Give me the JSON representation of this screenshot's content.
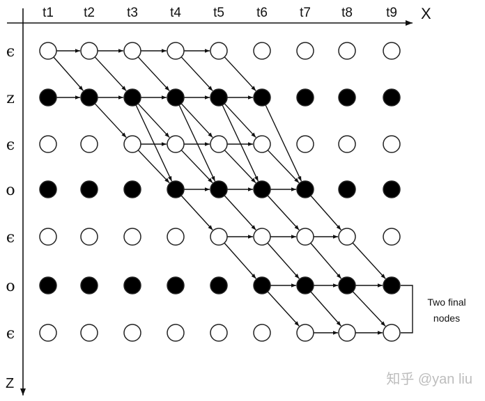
{
  "axes": {
    "x_label": "X",
    "z_label": "Z"
  },
  "columns": [
    "t1",
    "t2",
    "t3",
    "t4",
    "t5",
    "t6",
    "t7",
    "t8",
    "t9"
  ],
  "rows": [
    {
      "label": "ϵ",
      "type": "blank"
    },
    {
      "label": "z",
      "type": "label"
    },
    {
      "label": "ϵ",
      "type": "blank"
    },
    {
      "label": "o",
      "type": "label"
    },
    {
      "label": "ϵ",
      "type": "blank"
    },
    {
      "label": "o",
      "type": "label"
    },
    {
      "label": "ϵ",
      "type": "blank"
    }
  ],
  "edges": [
    [
      0,
      0,
      0,
      1
    ],
    [
      0,
      1,
      0,
      2
    ],
    [
      0,
      2,
      0,
      3
    ],
    [
      0,
      3,
      0,
      4
    ],
    [
      0,
      0,
      1,
      1
    ],
    [
      0,
      1,
      1,
      2
    ],
    [
      0,
      2,
      1,
      3
    ],
    [
      0,
      3,
      1,
      4
    ],
    [
      0,
      4,
      1,
      5
    ],
    [
      1,
      0,
      1,
      1
    ],
    [
      1,
      1,
      1,
      2
    ],
    [
      1,
      2,
      1,
      3
    ],
    [
      1,
      3,
      1,
      4
    ],
    [
      1,
      4,
      1,
      5
    ],
    [
      1,
      1,
      2,
      2
    ],
    [
      1,
      2,
      2,
      3
    ],
    [
      1,
      3,
      2,
      4
    ],
    [
      1,
      4,
      2,
      5
    ],
    [
      1,
      2,
      3,
      3
    ],
    [
      1,
      3,
      3,
      4
    ],
    [
      1,
      4,
      3,
      5
    ],
    [
      1,
      5,
      3,
      6
    ],
    [
      2,
      2,
      2,
      3
    ],
    [
      2,
      3,
      2,
      4
    ],
    [
      2,
      4,
      2,
      5
    ],
    [
      2,
      2,
      3,
      3
    ],
    [
      2,
      3,
      3,
      4
    ],
    [
      2,
      4,
      3,
      5
    ],
    [
      2,
      5,
      3,
      6
    ],
    [
      3,
      3,
      3,
      4
    ],
    [
      3,
      4,
      3,
      5
    ],
    [
      3,
      5,
      3,
      6
    ],
    [
      3,
      3,
      4,
      4
    ],
    [
      3,
      4,
      4,
      5
    ],
    [
      3,
      5,
      4,
      6
    ],
    [
      3,
      6,
      4,
      7
    ],
    [
      4,
      4,
      4,
      5
    ],
    [
      4,
      5,
      4,
      6
    ],
    [
      4,
      6,
      4,
      7
    ],
    [
      4,
      4,
      5,
      5
    ],
    [
      4,
      5,
      5,
      6
    ],
    [
      4,
      6,
      5,
      7
    ],
    [
      4,
      7,
      5,
      8
    ],
    [
      5,
      5,
      5,
      6
    ],
    [
      5,
      6,
      5,
      7
    ],
    [
      5,
      7,
      5,
      8
    ],
    [
      5,
      5,
      6,
      6
    ],
    [
      5,
      6,
      6,
      7
    ],
    [
      5,
      7,
      6,
      8
    ],
    [
      6,
      6,
      6,
      7
    ],
    [
      6,
      7,
      6,
      8
    ]
  ],
  "annotation": {
    "line1": "Two final",
    "line2": "nodes"
  },
  "watermark": "知乎 @yan liu",
  "colors": {
    "ink": "#111111",
    "filled_node": "#000000",
    "empty_node": "#ffffff",
    "watermark": "#bdbdbd"
  }
}
